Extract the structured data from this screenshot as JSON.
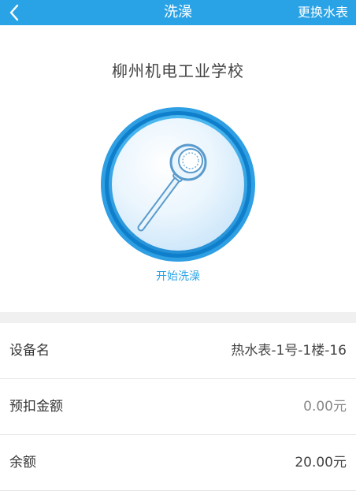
{
  "navbar": {
    "back_icon": "chevron-left-icon",
    "title": "洗澡",
    "right_action": "更换水表",
    "color": "#2aa3e6"
  },
  "main": {
    "school_name": "柳州机电工业学校",
    "shower_icon": "shower-head-icon",
    "start_label": "开始洗澡"
  },
  "details": [
    {
      "label": "设备名",
      "value": "热水表-1号-1楼-16"
    },
    {
      "label": "预扣金额",
      "value": "0.00元"
    },
    {
      "label": "余额",
      "value": "20.00元"
    }
  ]
}
